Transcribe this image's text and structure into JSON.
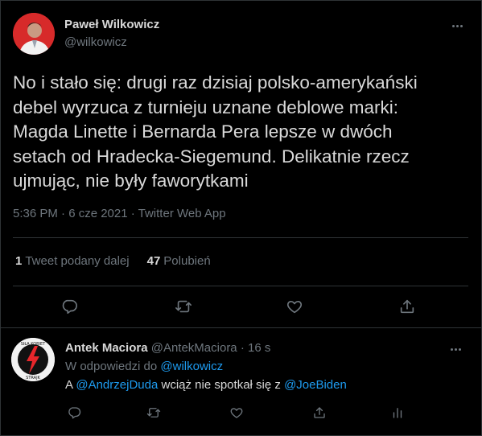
{
  "main_tweet": {
    "author_name": "Paweł Wilkowicz",
    "author_handle": "@wilkowicz",
    "text": "No i stało się: drugi raz dzisiaj polsko-amerykański\ndebel wyrzuca z turnieju uznane deblowe marki:\nMagda Linette i Bernarda Pera lepsze w dwóch\nsetach od Hradecka-Siegemund. Delikatnie rzecz\nujmując, nie były faworytkami",
    "timestamp": "5:36 PM · 6 cze 2021 · Twitter Web App",
    "retweet_count": "1",
    "retweet_label": "Tweet podany dalej",
    "like_count": "47",
    "like_label": "Polubień"
  },
  "reply_tweet": {
    "author_name": "Antek Maciora",
    "author_handle": "@AntekMaciora",
    "time_sep": "·",
    "time": "16 s",
    "replying_prefix": "W odpowiedzi do",
    "replying_to": "@wilkowicz",
    "text_prefix": "A",
    "mention1": "@AndrzejDuda",
    "text_middle": "wciąż nie spotkał się z",
    "mention2": "@JoeBiden",
    "avatar_text_top": "SIŁA KOBIET",
    "avatar_text_bottom": "STRAJK"
  },
  "colors": {
    "background": "#000000",
    "text": "#d9d9d9",
    "muted": "#6e767d",
    "link": "#1d9bf0",
    "border": "#2f3336",
    "avatar_red": "#e8262b"
  }
}
